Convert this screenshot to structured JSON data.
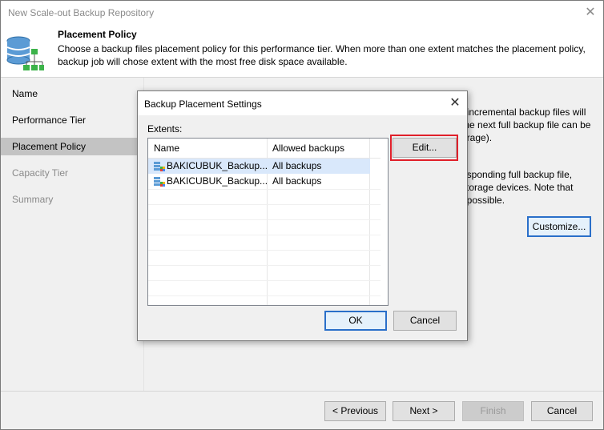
{
  "window": {
    "title": "New Scale-out Backup Repository",
    "close_glyph": "✕"
  },
  "header": {
    "title": "Placement Policy",
    "description": "Choose a backup files placement policy for this performance tier. When more than one extent matches the placement policy, backup job will chose extent with the most free disk space available.",
    "icon": "database-tree-icon"
  },
  "sidebar": {
    "items": [
      {
        "label": "Name",
        "state": "normal"
      },
      {
        "label": "Performance Tier",
        "state": "normal"
      },
      {
        "label": "Placement Policy",
        "state": "active"
      },
      {
        "label": "Capacity Tier",
        "state": "disabled"
      },
      {
        "label": "Summary",
        "state": "disabled"
      }
    ]
  },
  "main": {
    "partial_lines_1": [
      ", incremental backup files will",
      "the next full backup file can be",
      "orage)."
    ],
    "partial_lines_2": [
      "esponding full backup file,",
      "storage devices. Note that",
      "npossible."
    ],
    "customize_label": "Customize..."
  },
  "dialog": {
    "title": "Backup Placement Settings",
    "close_glyph": "✕",
    "extents_label": "Extents:",
    "columns": [
      "Name",
      "Allowed backups"
    ],
    "rows": [
      {
        "name": "BAKICUBUK_Backup...",
        "allowed": "All backups",
        "selected": true
      },
      {
        "name": "BAKICUBUK_Backup...",
        "allowed": "All backups",
        "selected": false
      }
    ],
    "edit_label": "Edit...",
    "ok_label": "OK",
    "cancel_label": "Cancel"
  },
  "footer": {
    "previous_label": "< Previous",
    "next_label": "Next >",
    "finish_label": "Finish",
    "cancel_label": "Cancel"
  },
  "colors": {
    "highlight": "#e0202a",
    "default_button_border": "#2a6fc9",
    "selected_row": "#d9e8fb"
  }
}
